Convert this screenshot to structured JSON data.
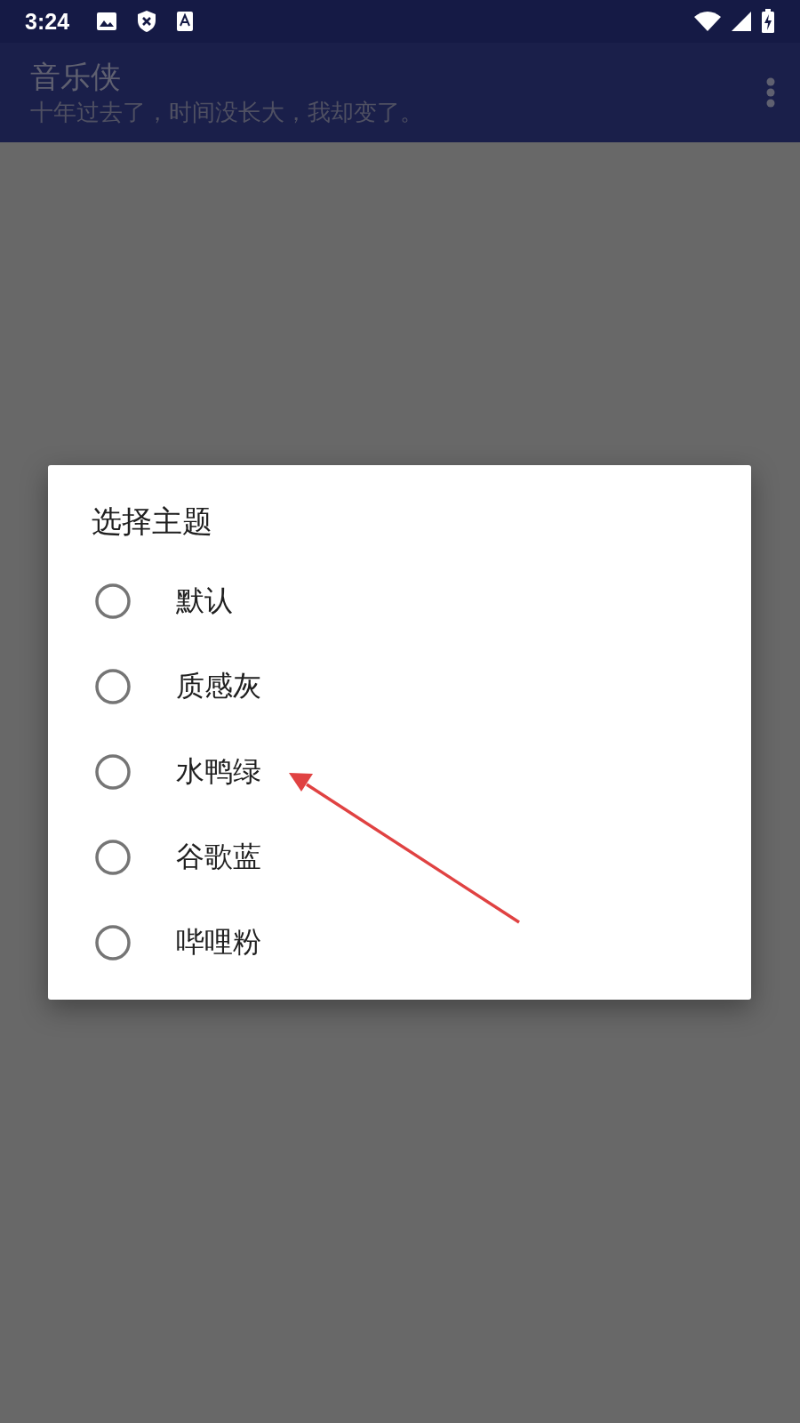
{
  "status_bar": {
    "time": "3:24"
  },
  "app_bar": {
    "title": "音乐侠",
    "subtitle": "十年过去了，时间没长大，我却变了。"
  },
  "dialog": {
    "title": "选择主题",
    "options": [
      {
        "label": "默认",
        "selected": false
      },
      {
        "label": "质感灰",
        "selected": false
      },
      {
        "label": "水鸭绿",
        "selected": false
      },
      {
        "label": "谷歌蓝",
        "selected": false
      },
      {
        "label": "哔哩粉",
        "selected": false
      }
    ]
  },
  "annotations": [
    {
      "kind": "arrow"
    }
  ]
}
